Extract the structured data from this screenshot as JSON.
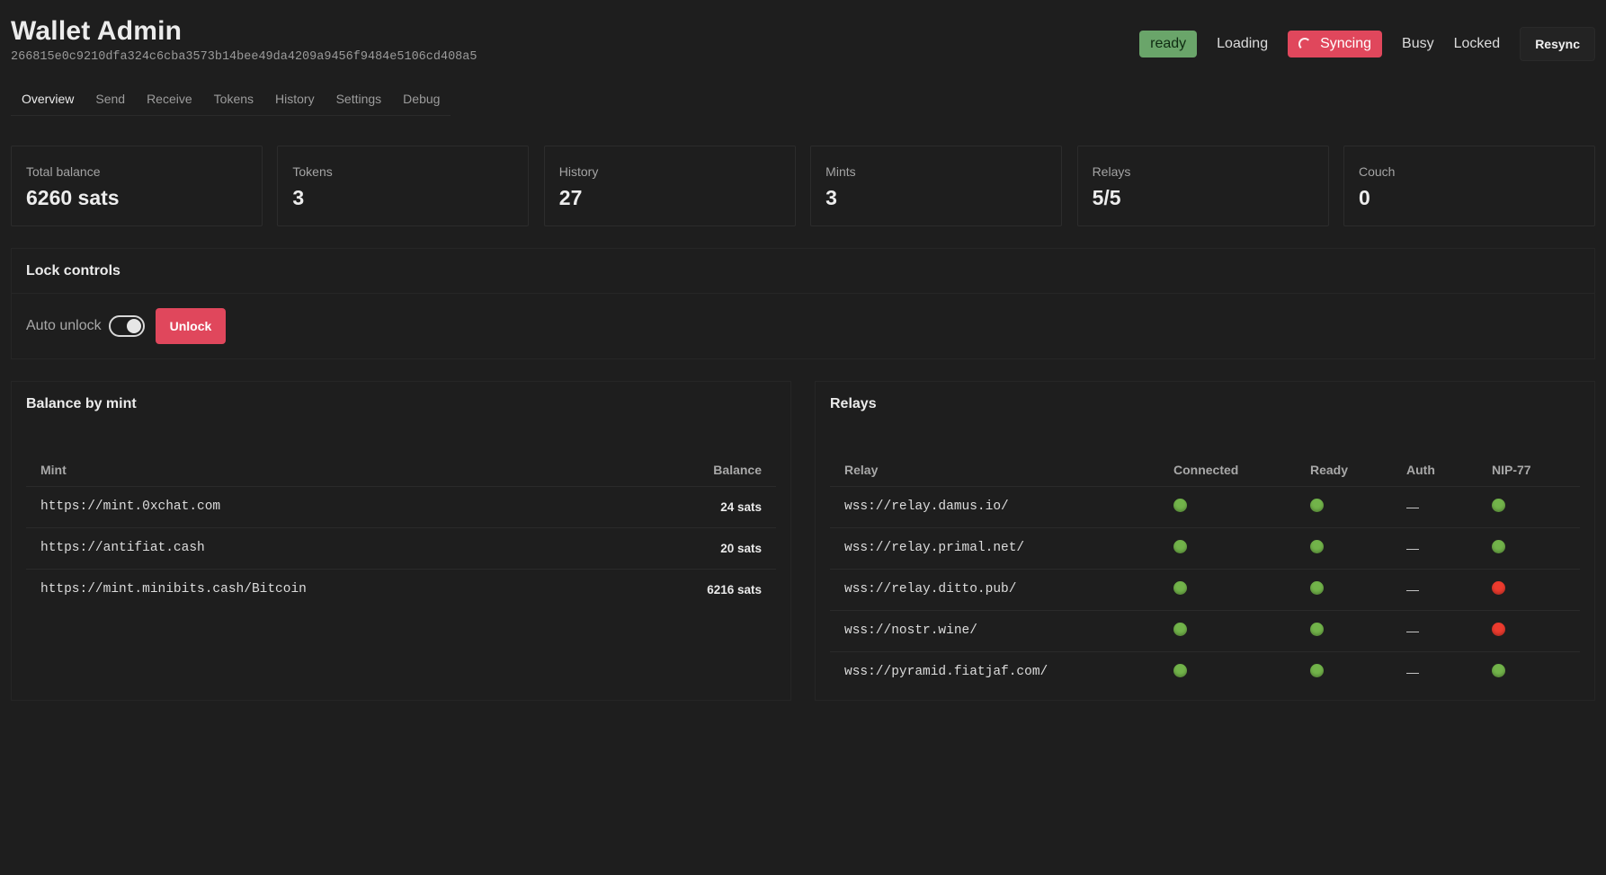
{
  "header": {
    "title": "Wallet Admin",
    "pubkey": "266815e0c9210dfa324c6cba3573b14bee49da4209a9456f9484e5106cd408a5"
  },
  "status": {
    "ready": "ready",
    "loading": "Loading",
    "syncing": "Syncing",
    "busy": "Busy",
    "locked": "Locked",
    "resync": "Resync",
    "colors": {
      "ready": "#6aa56a",
      "syncing": "#e0475c"
    }
  },
  "tabs": [
    {
      "label": "Overview",
      "active": true
    },
    {
      "label": "Send"
    },
    {
      "label": "Receive"
    },
    {
      "label": "Tokens"
    },
    {
      "label": "History"
    },
    {
      "label": "Settings"
    },
    {
      "label": "Debug"
    }
  ],
  "stats": [
    {
      "label": "Total balance",
      "value": "6260 sats"
    },
    {
      "label": "Tokens",
      "value": "3"
    },
    {
      "label": "History",
      "value": "27"
    },
    {
      "label": "Mints",
      "value": "3"
    },
    {
      "label": "Relays",
      "value": "5/5"
    },
    {
      "label": "Couch",
      "value": "0"
    }
  ],
  "lock": {
    "title": "Lock controls",
    "auto_unlock_label": "Auto unlock",
    "auto_unlock_on": true,
    "unlock_label": "Unlock"
  },
  "mints": {
    "title": "Balance by mint",
    "columns": [
      "Mint",
      "Balance"
    ],
    "rows": [
      {
        "mint": "https://mint.0xchat.com",
        "balance": "24 sats"
      },
      {
        "mint": "https://antifiat.cash",
        "balance": "20 sats"
      },
      {
        "mint": "https://mint.minibits.cash/Bitcoin",
        "balance": "6216 sats"
      }
    ]
  },
  "relays": {
    "title": "Relays",
    "columns": [
      "Relay",
      "Connected",
      "Ready",
      "Auth",
      "NIP-77"
    ],
    "dash": "—",
    "rows": [
      {
        "relay": "wss://relay.damus.io/",
        "connected": "green",
        "ready": "green",
        "auth": "—",
        "nip77": "green"
      },
      {
        "relay": "wss://relay.primal.net/",
        "connected": "green",
        "ready": "green",
        "auth": "—",
        "nip77": "green"
      },
      {
        "relay": "wss://relay.ditto.pub/",
        "connected": "green",
        "ready": "green",
        "auth": "—",
        "nip77": "red"
      },
      {
        "relay": "wss://nostr.wine/",
        "connected": "green",
        "ready": "green",
        "auth": "—",
        "nip77": "red"
      },
      {
        "relay": "wss://pyramid.fiatjaf.com/",
        "connected": "green",
        "ready": "green",
        "auth": "—",
        "nip77": "green"
      }
    ]
  }
}
